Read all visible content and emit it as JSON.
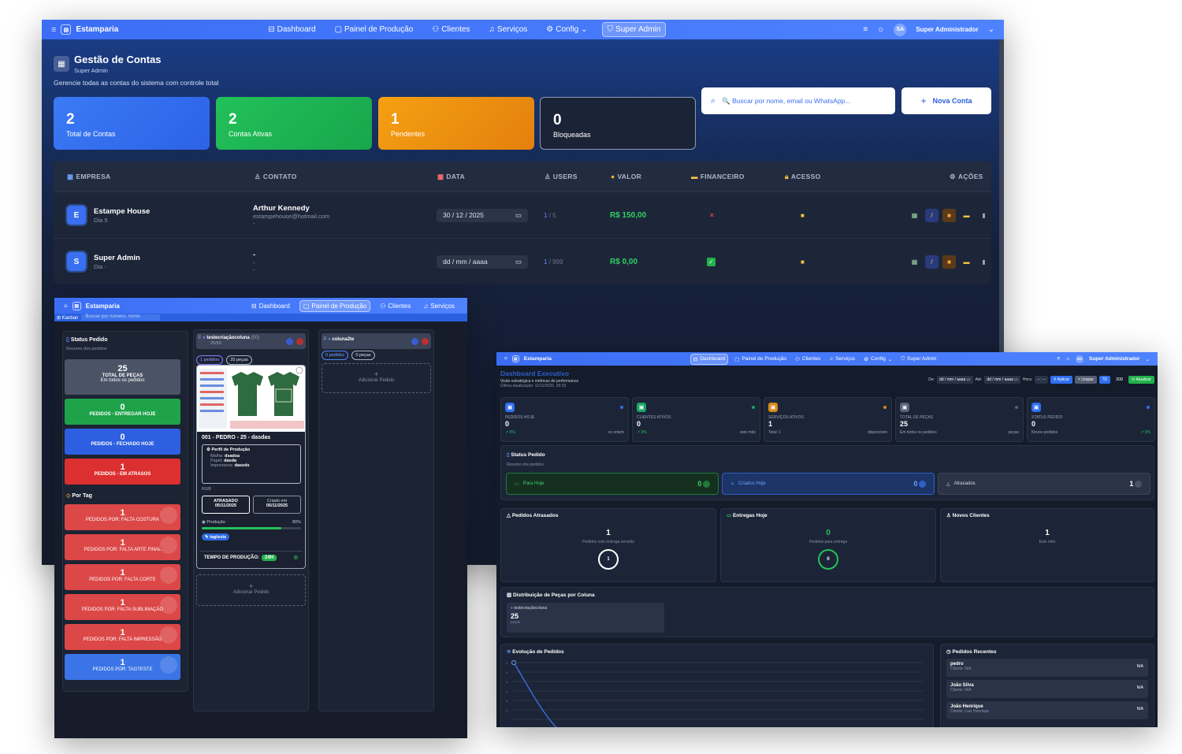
{
  "w1": {
    "nav": {
      "brand": "Estamparia",
      "links": [
        {
          "icon": "dashboard-icon",
          "glyph": "⊟",
          "label": "Dashboard"
        },
        {
          "icon": "board-icon",
          "glyph": "▢",
          "label": "Painel de Produção"
        },
        {
          "icon": "users-icon",
          "glyph": "⚇",
          "label": "Clientes"
        },
        {
          "icon": "bell-icon",
          "glyph": "♫",
          "label": "Serviços"
        },
        {
          "icon": "gear-icon",
          "glyph": "⚙",
          "label": "Config"
        },
        {
          "icon": "shield-icon",
          "glyph": "⛉",
          "label": "Super Admin"
        }
      ],
      "avatar": "SA",
      "user": "Super Administrador"
    },
    "header": {
      "title": "Gestão de Contas",
      "subtitle": "Super Admin",
      "description": "Gerencie todas as contas do sistema com controle total"
    },
    "stats": [
      {
        "value": "2",
        "label": "Total de Contas"
      },
      {
        "value": "2",
        "label": "Contas Ativas"
      },
      {
        "value": "1",
        "label": "Pendentes"
      },
      {
        "value": "0",
        "label": "Bloqueadas"
      }
    ],
    "search_placeholder": "🔍 Buscar por nome, email ou WhatsApp...",
    "new_account": "Nova Conta",
    "columns": [
      "EMPRESA",
      "CONTATO",
      "DATA",
      "USERS",
      "VALOR",
      "FINANCEIRO",
      "ACESSO",
      "AÇÕES"
    ],
    "rows": [
      {
        "initial": "E",
        "company": "Estampe House",
        "sub": "Dia 5",
        "contact": "Arthur Kennedy",
        "email": "estampehouse@hotmail.com",
        "extra": "-",
        "date": "30 / 12 / 2025",
        "users": "1",
        "users_max": "/ 5",
        "value": "R$ 150,00"
      },
      {
        "initial": "S",
        "company": "Super Admin",
        "sub": "Dia -",
        "contact": "-",
        "email": "-",
        "extra": "-",
        "date": "dd / mm / aaaa",
        "users": "1",
        "users_max": "/ 999",
        "value": "R$ 0,00"
      }
    ]
  },
  "w2": {
    "nav": {
      "brand": "Estamparia",
      "links": [
        "Dashboard",
        "Painel de Produção",
        "Clientes",
        "Serviços"
      ]
    },
    "tab": "Kanban",
    "search": "Buscar por número, nome",
    "side_title": "Status Pedido",
    "side_sub": "Resumo dos pedidos",
    "total": {
      "value": "25",
      "label": "TOTAL DE PEÇAS",
      "sub": "Em todos os pedidos"
    },
    "status_boxes": [
      {
        "value": "0",
        "label": "PEDIDOS - ENTREGAR HOJE",
        "color": "#1fa34a"
      },
      {
        "value": "0",
        "label": "PEDIDOS - FECHADO HOJE",
        "color": "#2d5fe0"
      },
      {
        "value": "1",
        "label": "PEDIDOS - EM ATRASOS",
        "color": "#dc2f2f"
      }
    ],
    "tag_title": "Por Tag",
    "tag_boxes": [
      {
        "value": "1",
        "label": "PEDIDOS POR: FALTA COSTURA",
        "color": "#dc4747"
      },
      {
        "value": "1",
        "label": "PEDIDOS POR: FALTA ARTE FINAL",
        "color": "#dc4747"
      },
      {
        "value": "1",
        "label": "PEDIDOS POR: FALTA CORTE",
        "color": "#dc4747"
      },
      {
        "value": "1",
        "label": "PEDIDOS POR: FALTA SUBLIMAÇÃO",
        "color": "#dc4747"
      },
      {
        "value": "1",
        "label": "PEDIDOS POR: FALTA IMPRESSÃO",
        "color": "#dc4747"
      },
      {
        "value": "1",
        "label": "PEDIDOS POR: TAGTESTE",
        "color": "#3a74e6"
      }
    ],
    "col1": {
      "title": "testecriaçãocoluna",
      "count": "(50)",
      "cap": "25/50",
      "chip1": "1 pedidos",
      "chip2": "25 peças"
    },
    "card": {
      "title": "001 - PEDRO - 25 - dasdas",
      "profile_title": "Perfil de Produção",
      "malha_label": "Malha:",
      "malha": "dsadsa",
      "papel_label": "Papel:",
      "papel": "dasda",
      "imp_label": "Impressora:",
      "imp": "dassds",
      "rgb": "RGB",
      "late": "ATRASADO",
      "late_date": "05/11/2025",
      "created": "Criado em",
      "created_date": "05/11/2025",
      "prod_label": "Produção",
      "prod_pct": "80%",
      "progress": 0.8,
      "tag": "tagteste",
      "time_label": "TEMPO DE PRODUÇÃO:",
      "time": "24H"
    },
    "add_order": "Adicionar Pedido",
    "col2": {
      "title": "coluna2te",
      "chip1": "0 pedidos",
      "chip2": "0 peças"
    }
  },
  "w3": {
    "nav": {
      "brand": "Estamparia",
      "links": [
        "Dashboard",
        "Painel de Produção",
        "Clientes",
        "Serviços",
        "Config",
        "Super Admin"
      ],
      "avatar": "SA",
      "user": "Super Administrador"
    },
    "title": "Dashboard Executivo",
    "subtitle": "Visão estratégica e métricas de performance",
    "updated": "Última atualização: 11/11/2025, 09:33",
    "filters": {
      "de": "De:",
      "ate": "Até:",
      "hora": "Hora:",
      "date_ph": "dd / mm / aaaa",
      "time_ph": "-- : --",
      "apply": "Aplicar",
      "clear": "Limpar",
      "d7": "7D",
      "d30": "30D",
      "refresh": "Atualizar"
    },
    "kpis": [
      {
        "label": "PEDIDOS HOJE",
        "value": "0",
        "trend": "↗ 0%",
        "foot": "vs ontem",
        "color": "#2f6ff0"
      },
      {
        "label": "CLIENTES ATIVOS",
        "value": "0",
        "trend": "↗ 0%",
        "foot": "este mês",
        "color": "#19a566"
      },
      {
        "label": "SERVIÇOS ATIVOS",
        "value": "1",
        "trend": "Total: 1",
        "foot": "disponíveis",
        "color": "#d9871a"
      },
      {
        "label": "TOTAL DE PEÇAS",
        "value": "25",
        "trend": "Em todos os pedidos",
        "foot": "peças",
        "color": "#55627a"
      },
      {
        "label": "STATUS PEDIDO",
        "value": "0",
        "trend": "Novos pedidos",
        "foot": "↗ 0%",
        "color": "#2f6ff0"
      }
    ],
    "status": {
      "title": "Status Pedido",
      "sub": "Resumo dos pedidos",
      "items": [
        {
          "label": "Para Hoje",
          "value": "0"
        },
        {
          "label": "Criados Hoje",
          "value": "0"
        },
        {
          "label": "Atrasados",
          "value": "1"
        }
      ]
    },
    "cards": [
      {
        "title": "Pedidos Atrasados",
        "value": "1",
        "sub": "Pedidos com entrega vencida",
        "ring": "1"
      },
      {
        "title": "Entregas Hoje",
        "value": "0",
        "sub": "Pedidos para entrega",
        "ring": "0"
      },
      {
        "title": "Novos Clientes",
        "value": "1",
        "sub": "Este mês"
      }
    ],
    "dist": {
      "title": "Distribuição de Peças por Coluna",
      "col": "testecriaçãocoluna",
      "value": "25",
      "unit": "peças"
    },
    "evolution": {
      "title": "Evolução de Pedidos",
      "yticks": [
        "1",
        "1",
        "1",
        "1",
        "1",
        "1"
      ]
    },
    "recent": {
      "title": "Pedidos Recentes",
      "items": [
        {
          "name": "pedro",
          "client": "Cliente: N/A",
          "badge": "N/A"
        },
        {
          "name": "João Silva",
          "client": "Cliente: N/A",
          "badge": "N/A"
        },
        {
          "name": "João Henrique",
          "client": "Cliente: Luiz Henrique",
          "badge": "N/A"
        }
      ]
    }
  }
}
